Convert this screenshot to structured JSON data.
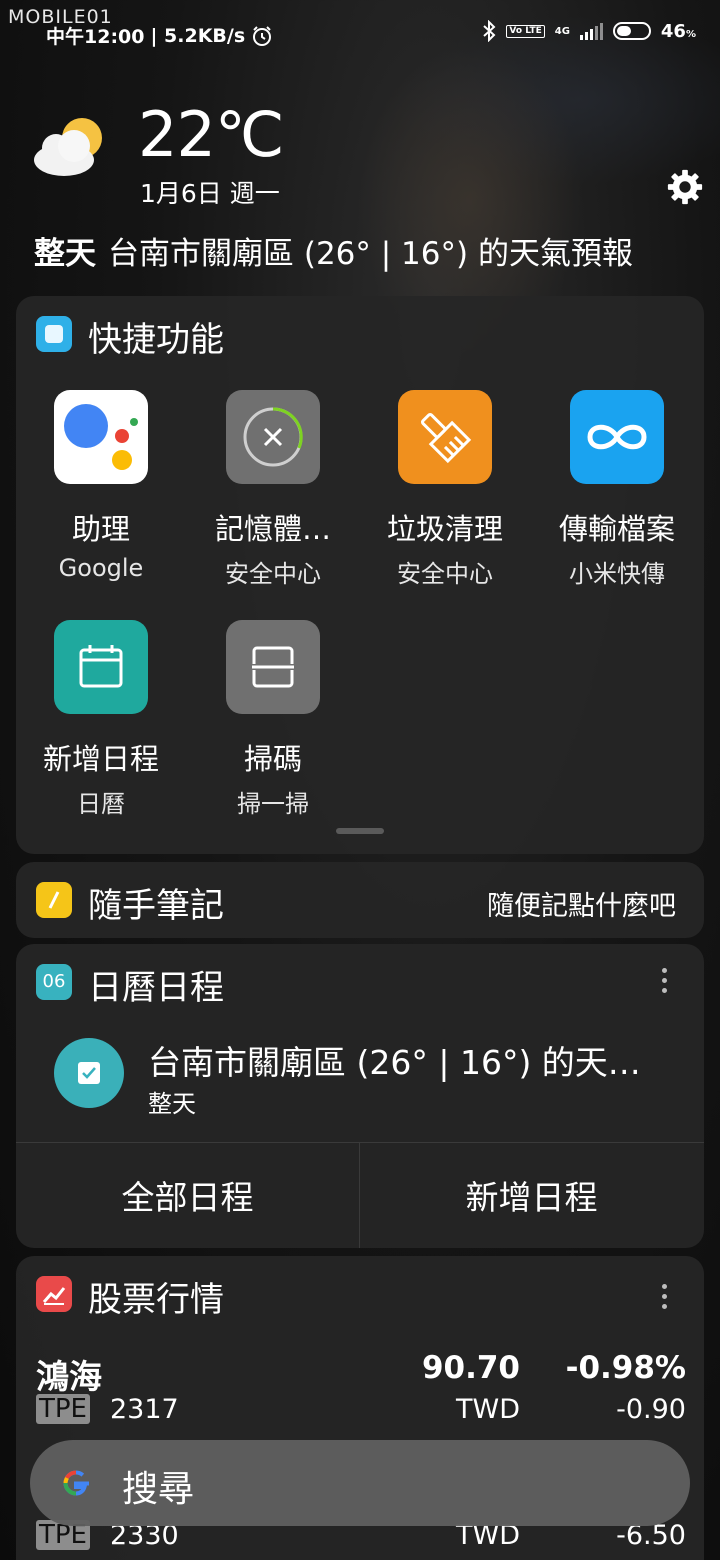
{
  "status_bar": {
    "watermark": "MOBILE01",
    "time": "中午12:00",
    "net_speed": "| 5.2KB/s",
    "network": "4G",
    "volte": "Vo LTE",
    "battery": "46",
    "battery_unit": "%",
    "battery_level": 0.46
  },
  "weather": {
    "temperature": "22℃",
    "date": "1月6日 週一",
    "forecast_prefix": "整天",
    "forecast_text": "台南市關廟區 (26° | 16°) 的天氣預報"
  },
  "quick_actions": {
    "title": "快捷功能",
    "apps": [
      {
        "name": "助理",
        "sub": "Google",
        "icon": "google-assistant-icon"
      },
      {
        "name": "記憶體…",
        "sub": "安全中心",
        "icon": "memory-clean-icon"
      },
      {
        "name": "垃圾清理",
        "sub": "安全中心",
        "icon": "broom-icon"
      },
      {
        "name": "傳輸檔案",
        "sub": "小米快傳",
        "icon": "infinity-icon"
      },
      {
        "name": "新增日程",
        "sub": "日曆",
        "icon": "calendar-icon"
      },
      {
        "name": "掃碼",
        "sub": "掃一掃",
        "icon": "scan-icon"
      }
    ]
  },
  "notes": {
    "title": "隨手筆記",
    "hint": "隨便記點什麼吧"
  },
  "calendar": {
    "title": "日曆日程",
    "badge": "06",
    "event_title": "台南市關廟區 (26° | 16°) 的天…",
    "event_sub": "整天",
    "all_button": "全部日程",
    "add_button": "新增日程"
  },
  "stocks": {
    "title": "股票行情",
    "rows": [
      {
        "name": "鴻海",
        "price": "90.70",
        "pct": "-0.98%",
        "exchange": "TPE",
        "code": "2317",
        "currency": "TWD",
        "change": "-0.90"
      },
      {
        "name": "",
        "price": "",
        "pct": "",
        "exchange": "TPE",
        "code": "2330",
        "currency": "TWD",
        "change": "-6.50"
      }
    ]
  },
  "search": {
    "label": "搜尋"
  },
  "colors": {
    "assistant_bg": "#ffffff",
    "memory_bg": "#707070",
    "broom_bg": "#f0901e",
    "transfer_bg": "#1aa3f0",
    "calendar_bg": "#1fa99e",
    "scan_bg": "#707070",
    "notes_icon": "#f5c518",
    "calendar_icon": "#38b2bf",
    "stocks_icon": "#e94a4a",
    "quick_icon": "#2fb0e8"
  }
}
